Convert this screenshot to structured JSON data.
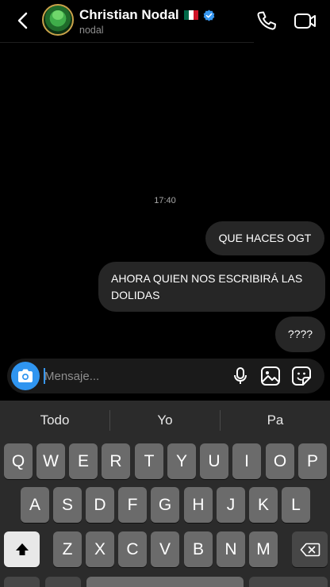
{
  "header": {
    "name": "Christian Nodal",
    "username": "nodal",
    "flag_colors": [
      "#006847",
      "#ffffff",
      "#ce1126"
    ],
    "verified_color": "#3797f0",
    "icons": [
      "back-arrow-icon",
      "phone-icon",
      "video-call-icon"
    ]
  },
  "conversation": {
    "timestamp": "17:40",
    "messages": [
      {
        "text": "QUE HACES OGT"
      },
      {
        "text": "AHORA QUIEN NOS ESCRIBIRÁ LAS DOLIDAS"
      },
      {
        "text": "????"
      }
    ]
  },
  "composer": {
    "placeholder": "Mensaje...",
    "camera_color": "#2f95f0",
    "icons": [
      "camera-icon",
      "microphone-icon",
      "gallery-icon",
      "sticker-icon"
    ]
  },
  "keyboard": {
    "suggestions": [
      "Todo",
      "Yo",
      "Pa"
    ],
    "row1": [
      "Q",
      "W",
      "E",
      "R",
      "T",
      "Y",
      "U",
      "I",
      "O",
      "P"
    ],
    "row2": [
      "A",
      "S",
      "D",
      "F",
      "G",
      "H",
      "J",
      "K",
      "L"
    ],
    "row3": [
      "Z",
      "X",
      "C",
      "V",
      "B",
      "N",
      "M"
    ]
  }
}
